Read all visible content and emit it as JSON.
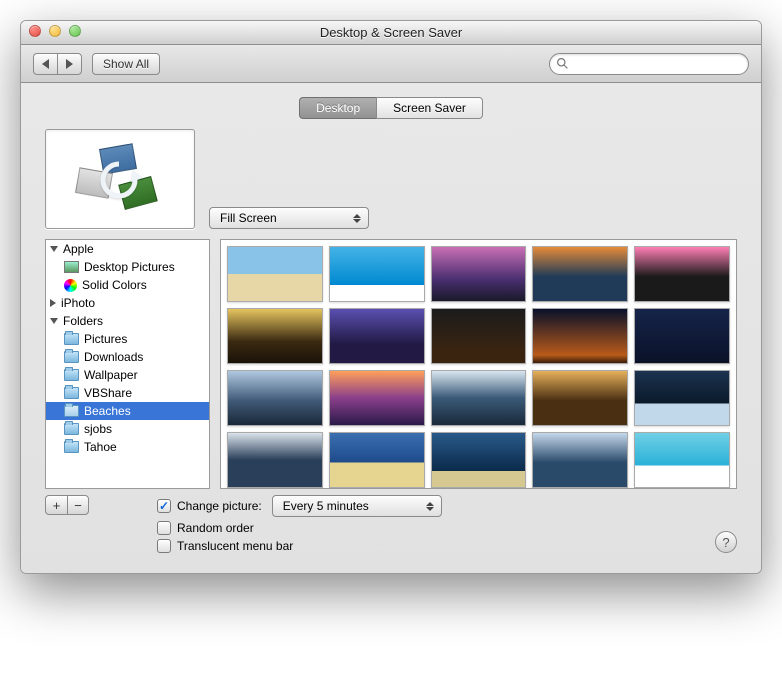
{
  "window": {
    "title": "Desktop & Screen Saver"
  },
  "toolbar": {
    "show_all": "Show All",
    "search_placeholder": ""
  },
  "tabs": {
    "desktop": "Desktop",
    "screensaver": "Screen Saver",
    "active": "desktop"
  },
  "scaling": {
    "selected": "Fill Screen"
  },
  "sidebar": {
    "sections": [
      {
        "label": "Apple",
        "expanded": true,
        "items": [
          {
            "label": "Desktop Pictures",
            "icon": "picture"
          },
          {
            "label": "Solid Colors",
            "icon": "colorwheel"
          }
        ]
      },
      {
        "label": "iPhoto",
        "expanded": false,
        "items": []
      },
      {
        "label": "Folders",
        "expanded": true,
        "items": [
          {
            "label": "Pictures",
            "icon": "folder"
          },
          {
            "label": "Downloads",
            "icon": "folder"
          },
          {
            "label": "Wallpaper",
            "icon": "folder"
          },
          {
            "label": "VBShare",
            "icon": "folder"
          },
          {
            "label": "Beaches",
            "icon": "folder",
            "selected": true
          },
          {
            "label": "sjobs",
            "icon": "folder"
          },
          {
            "label": "Tahoe",
            "icon": "folder"
          }
        ]
      }
    ]
  },
  "options": {
    "change_picture_label": "Change picture:",
    "change_picture_checked": true,
    "interval": "Every 5 minutes",
    "random_order_label": "Random order",
    "random_order_checked": false,
    "translucent_label": "Translucent menu bar",
    "translucent_checked": false
  },
  "buttons": {
    "plus": "+",
    "minus": "−",
    "help": "?"
  }
}
